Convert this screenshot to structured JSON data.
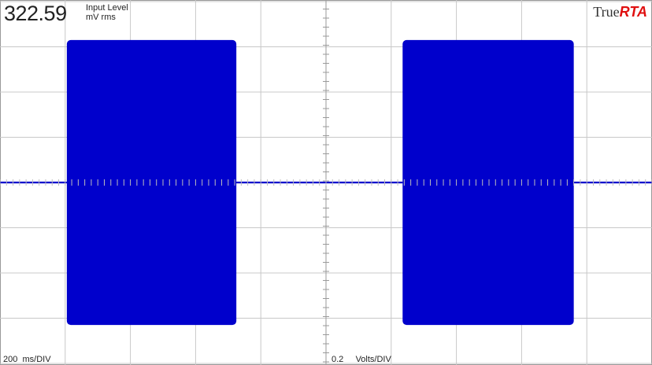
{
  "input_level": {
    "value": "322.59",
    "label_line1": "Input Level",
    "label_line2": "mV rms"
  },
  "brand": {
    "part1": "True",
    "part2": "RTA"
  },
  "timebase": {
    "value": "200",
    "unit": "ms/DIV"
  },
  "vertical_scale": {
    "value": "0.2",
    "unit": "Volts/DIV"
  },
  "trace": {
    "color": "#0000cc",
    "grid_color": "#c8c8c8",
    "bursts": [
      {
        "start_div": 2.05,
        "end_div": 7.25
      },
      {
        "start_div": 12.35,
        "end_div": 17.6
      }
    ],
    "burst_peak_div": 3.15
  }
}
